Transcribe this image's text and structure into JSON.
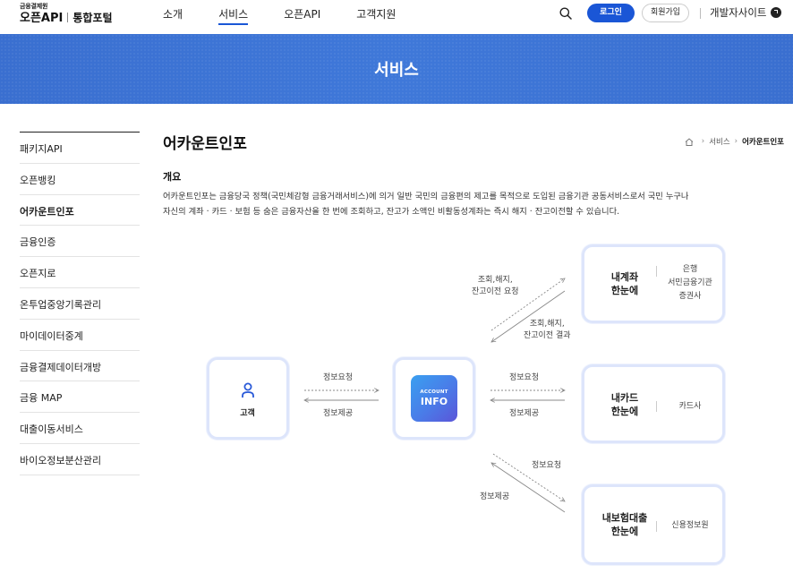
{
  "header": {
    "logo_small": "금융결제원",
    "logo_main": "오픈API",
    "logo_sub": "통합포털",
    "nav": [
      "소개",
      "서비스",
      "오픈API",
      "고객지원"
    ],
    "login_label": "로그인",
    "join_label": "회원가입",
    "dev_site_label": "개발자사이트"
  },
  "banner": {
    "title": "서비스"
  },
  "sidebar": {
    "items": [
      "패키지API",
      "오픈뱅킹",
      "어카운트인포",
      "금융인증",
      "오픈지로",
      "온투업중앙기록관리",
      "마이데이터중계",
      "금융결제데이터개방",
      "금융 MAP",
      "대출이동서비스",
      "바이오정보분산관리"
    ]
  },
  "content": {
    "title": "어카운트인포",
    "breadcrumb": [
      "서비스",
      "어카운트인포"
    ],
    "section_title": "개요",
    "description_1": "어카운트인포는 금융당국 정책(국민체감형 금융거래서비스)에 의거 일반 국민의 금융편의 제고를 목적으로 도입된 금융기관 공동서비스로서 국민 누구나",
    "description_2": "자신의 계좌 · 카드 · 보험 등 숨은 금융자산을 한 번에 조회하고, 잔고가 소액인 비활동성계좌는 즉시 해지 · 잔고이전할 수 있습니다."
  },
  "diagram": {
    "customer": "고객",
    "account_logo_top": "ACCOUNT",
    "account_logo_bottom": "INFO",
    "bank_title_1": "내계좌",
    "bank_title_2": "한눈에",
    "bank_members": [
      "은행",
      "서민금융기관",
      "증권사"
    ],
    "card_title_1": "내카드",
    "card_title_2": "한눈에",
    "card_members": [
      "카드사"
    ],
    "insure_title_1": "내보험대출",
    "insure_title_2": "한눈에",
    "insure_members": [
      "신용정보원"
    ],
    "flow_left_request": "정보요청",
    "flow_left_provide": "정보제공",
    "flow_card_request": "정보요청",
    "flow_card_provide": "정보제공",
    "flow_bank_request_1": "조회,해지,",
    "flow_bank_request_2": "잔고이전 요청",
    "flow_bank_result_1": "조회,해지,",
    "flow_bank_result_2": "잔고이전 결과",
    "flow_insure_request": "정보요청",
    "flow_insure_provide": "정보제공"
  }
}
